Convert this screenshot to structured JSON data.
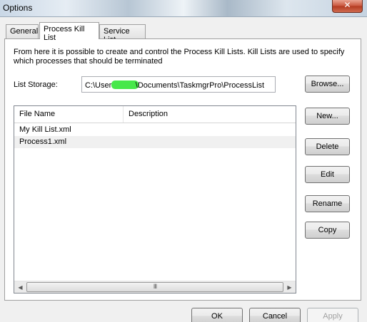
{
  "window": {
    "title": "Options",
    "close_label": "✕"
  },
  "tabs": [
    {
      "label": "General"
    },
    {
      "label": "Process Kill List"
    },
    {
      "label": "Service List"
    }
  ],
  "panel": {
    "description": "From here it is possible to create and control the Process Kill Lists. Kill Lists are used to specify which processes that should be terminated",
    "storage_label": "List Storage:",
    "storage_path_prefix": "C:\\Users",
    "storage_path_suffix": "\\Documents\\TaskmgrPro\\ProcessList",
    "browse_label": "Browse...",
    "columns": [
      "File Name",
      "Description"
    ],
    "rows": [
      {
        "file_name": "My Kill List.xml",
        "description": ""
      },
      {
        "file_name": "Process1.xml",
        "description": ""
      }
    ],
    "side_buttons": {
      "new": "New...",
      "delete": "Delete",
      "edit": "Edit",
      "rename": "Rename",
      "copy": "Copy"
    },
    "scroll": {
      "left": "◀",
      "right": "▶",
      "grip": "III"
    }
  },
  "footer": {
    "ok": "OK",
    "cancel": "Cancel",
    "apply": "Apply"
  }
}
